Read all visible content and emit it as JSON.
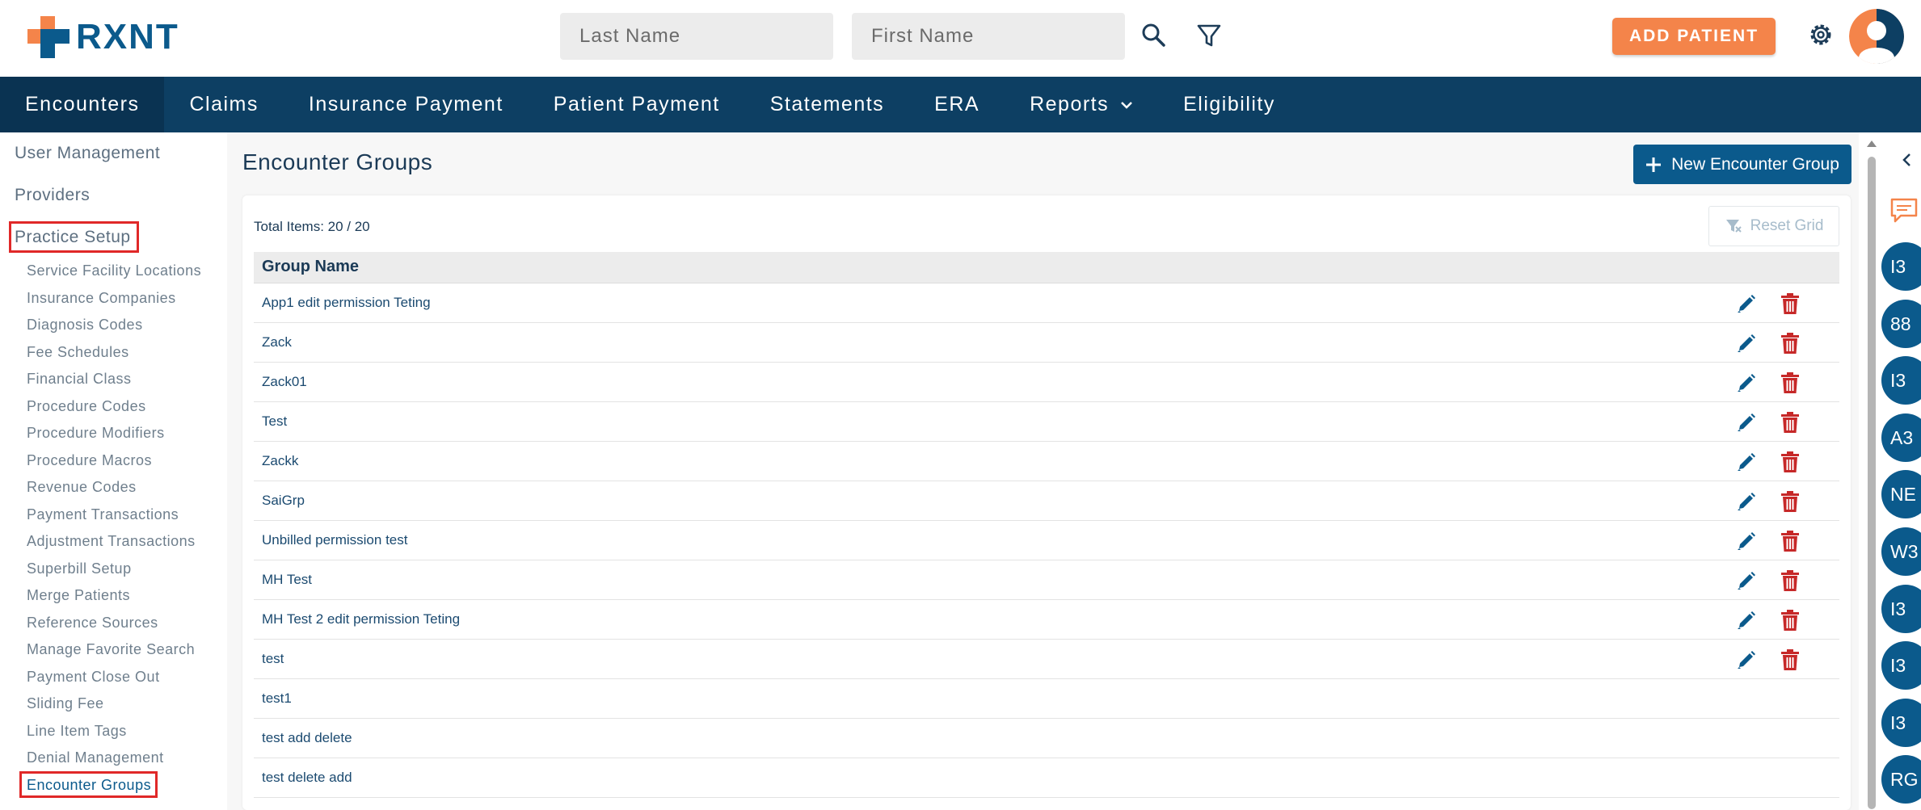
{
  "header": {
    "logo_text": "RXNT",
    "last_name_placeholder": "Last Name",
    "first_name_placeholder": "First Name",
    "add_patient_label": "ADD PATIENT"
  },
  "nav": {
    "items": [
      "Encounters",
      "Claims",
      "Insurance Payment",
      "Patient Payment",
      "Statements",
      "ERA",
      "Reports",
      "Eligibility"
    ]
  },
  "sidebar": {
    "top_items": [
      "User Management",
      "Providers",
      "Practice Setup"
    ],
    "sub_items": [
      "Service Facility Locations",
      "Insurance Companies",
      "Diagnosis Codes",
      "Fee Schedules",
      "Financial Class",
      "Procedure Codes",
      "Procedure Modifiers",
      "Procedure Macros",
      "Revenue Codes",
      "Payment Transactions",
      "Adjustment Transactions",
      "Superbill Setup",
      "Merge Patients",
      "Reference Sources",
      "Manage Favorite Search",
      "Payment Close Out",
      "Sliding Fee",
      "Line Item Tags",
      "Denial Management",
      "Encounter Groups"
    ]
  },
  "main": {
    "title": "Encounter Groups",
    "new_group_label": "New Encounter Group",
    "total_items": "Total Items: 20 / 20",
    "reset_grid_label": "Reset Grid",
    "column_header": "Group Name",
    "rows": [
      {
        "name": "App1 edit permission Teting",
        "actions": true
      },
      {
        "name": "Zack",
        "actions": true
      },
      {
        "name": "Zack01",
        "actions": true
      },
      {
        "name": "Test",
        "actions": true
      },
      {
        "name": "Zackk",
        "actions": true
      },
      {
        "name": "SaiGrp",
        "actions": true
      },
      {
        "name": "Unbilled permission test",
        "actions": true
      },
      {
        "name": "MH Test",
        "actions": true
      },
      {
        "name": "MH Test 2 edit permission Teting",
        "actions": true
      },
      {
        "name": "test",
        "actions": true
      },
      {
        "name": "test1",
        "actions": false
      },
      {
        "name": "test add delete",
        "actions": false
      },
      {
        "name": "test delete add",
        "actions": false
      }
    ]
  },
  "right_rail": {
    "badges": [
      "I3",
      "88",
      "I3",
      "A3",
      "NE",
      "W3",
      "I3",
      "I3",
      "I3",
      "RG"
    ]
  },
  "colors": {
    "brand_blue": "#0b5a8c",
    "nav_bg": "#0d3f63",
    "accent_orange": "#f4844a",
    "delete_red": "#c62828",
    "highlight_red": "#e02828"
  }
}
